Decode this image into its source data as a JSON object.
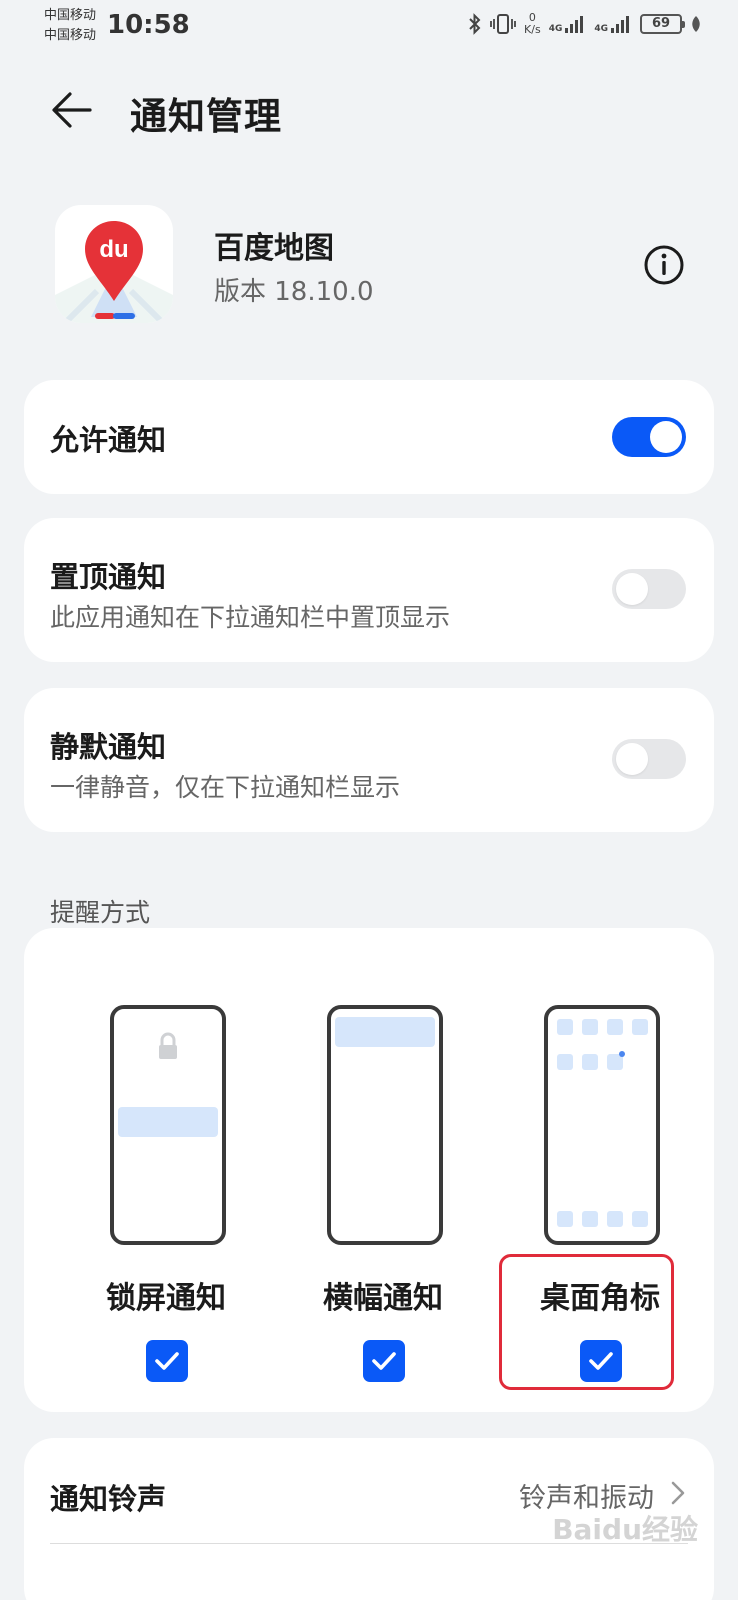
{
  "status_bar": {
    "carrier_1": "中国移动",
    "carrier_2": "中国移动",
    "time": "10:58",
    "net_speed_value": "0",
    "net_speed_unit": "K/s",
    "network_1": "4G",
    "network_2": "4G",
    "battery": "69"
  },
  "header": {
    "title": "通知管理"
  },
  "app": {
    "name": "百度地图",
    "version": "版本 18.10.0",
    "icon_text": "du"
  },
  "settings": {
    "allow": {
      "title": "允许通知",
      "enabled": true
    },
    "pinned": {
      "title": "置顶通知",
      "subtitle": "此应用通知在下拉通知栏中置顶显示",
      "enabled": false
    },
    "silent": {
      "title": "静默通知",
      "subtitle": "一律静音，仅在下拉通知栏显示",
      "enabled": false
    }
  },
  "reminder": {
    "section_label": "提醒方式",
    "options": [
      {
        "label": "锁屏通知",
        "checked": true
      },
      {
        "label": "横幅通知",
        "checked": true
      },
      {
        "label": "桌面角标",
        "checked": true
      }
    ]
  },
  "ringtone": {
    "title": "通知铃声",
    "value": "铃声和振动"
  },
  "watermark": "Baidu经验",
  "colors": {
    "accent": "#0a59f7",
    "highlight": "#e02b3a",
    "background": "#f1f3f5"
  }
}
